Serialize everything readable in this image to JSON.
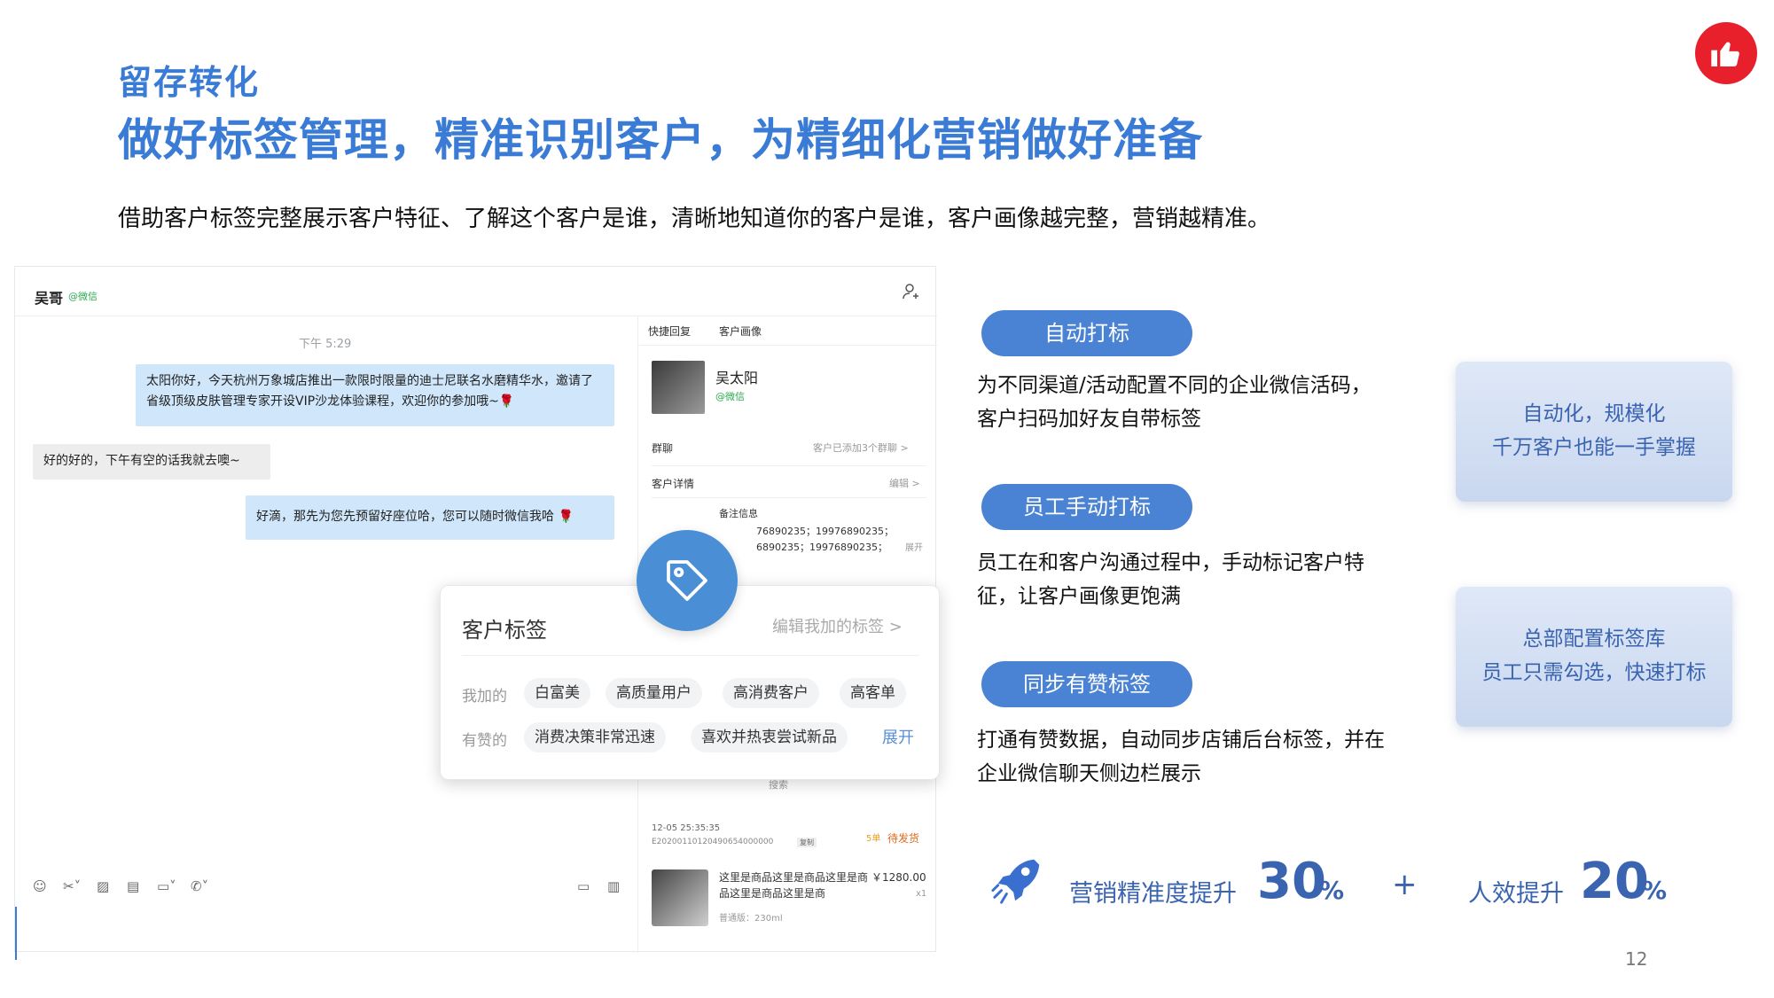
{
  "header": {
    "subtitle": "留存转化",
    "title": "做好标签管理，精准识别客户，为精细化营销做好准备",
    "description": "借助客户标签完整展示客户特征、了解这个客户是谁，清晰地知道你的客户是谁，客户画像越完整，营销越精准。"
  },
  "chat": {
    "contact_name": "吴哥",
    "contact_source": "@微信",
    "time": "下午 5:29",
    "messages": [
      {
        "text": "太阳你好，今天杭州万象城店推出一款限时限量的迪士尼联名水磨精华水，邀请了省级顶级皮肤管理专家开设VIP沙龙体验课程，欢迎你的参加哦~🌹"
      },
      {
        "text": "好的好的，下午有空的话我就去噢~"
      },
      {
        "text": "好滴，那先为您先预留好座位哈，您可以随时微信我哈 🌹"
      }
    ],
    "toolbar_icons": [
      "emoji-icon",
      "scissors-icon",
      "image-icon",
      "file-icon",
      "folder-icon",
      "phone-icon"
    ]
  },
  "panel": {
    "tabs": [
      "快捷回复",
      "客户画像"
    ],
    "customer_name": "吴太阳",
    "customer_source": "@微信",
    "group_label": "群聊",
    "group_value": "客户已添加3个群聊 >",
    "detail_label": "客户详情",
    "detail_edit": "编辑 >",
    "remark_label": "备注信息",
    "phone_line1": "76890235；19976890235；",
    "phone_line2": "6890235；19976890235；",
    "expand_small": "展开",
    "search_placeholder": "搜索",
    "order_time": "12-05 25:35:35",
    "order_id": "E20200110120490654000000",
    "order_copy": "复制",
    "order_count": "5单",
    "order_status": "待发货",
    "product_name": "这里是商品这里是商品这里是商品这里是商品这里是商",
    "product_price": "￥1280.00",
    "product_qty": "x1",
    "product_spec": "普通版：230ml"
  },
  "tag_card": {
    "title": "客户标签",
    "edit_label": "编辑我加的标签 >",
    "mine_label": "我加的",
    "mine_tags": [
      "白富美",
      "高质量用户",
      "高消费客户",
      "高客单"
    ],
    "youzan_label": "有赞的",
    "youzan_tags": [
      "消费决策非常迅速",
      "喜欢并热衷尝试新品"
    ],
    "expand_label": "展开"
  },
  "features": [
    {
      "pill": "自动打标",
      "text": "为不同渠道/活动配置不同的企业微信活码，客户扫码加好友自带标签"
    },
    {
      "pill": "员工手动打标",
      "text": "员工在和客户沟通过程中，手动标记客户特征，让客户画像更饱满"
    },
    {
      "pill": "同步有赞标签",
      "text": "打通有赞数据，自动同步店铺后台标签，并在企业微信聊天侧边栏展示"
    }
  ],
  "callouts": [
    {
      "line1": "自动化，规模化",
      "line2": "千万客户也能一手掌握"
    },
    {
      "line1": "总部配置标签库",
      "line2": "员工只需勾选，快速打标"
    }
  ],
  "stats": {
    "label1": "营销精准度提升",
    "value1": "30",
    "unit1": "%",
    "plus": "+",
    "label2": "人效提升",
    "value2": "20",
    "unit2": "%"
  },
  "page_number": "12",
  "colors": {
    "accent": "#3a7bd5",
    "pill": "#4a82d4",
    "logo": "#e8202b",
    "bubble": "#cfe6fb"
  }
}
